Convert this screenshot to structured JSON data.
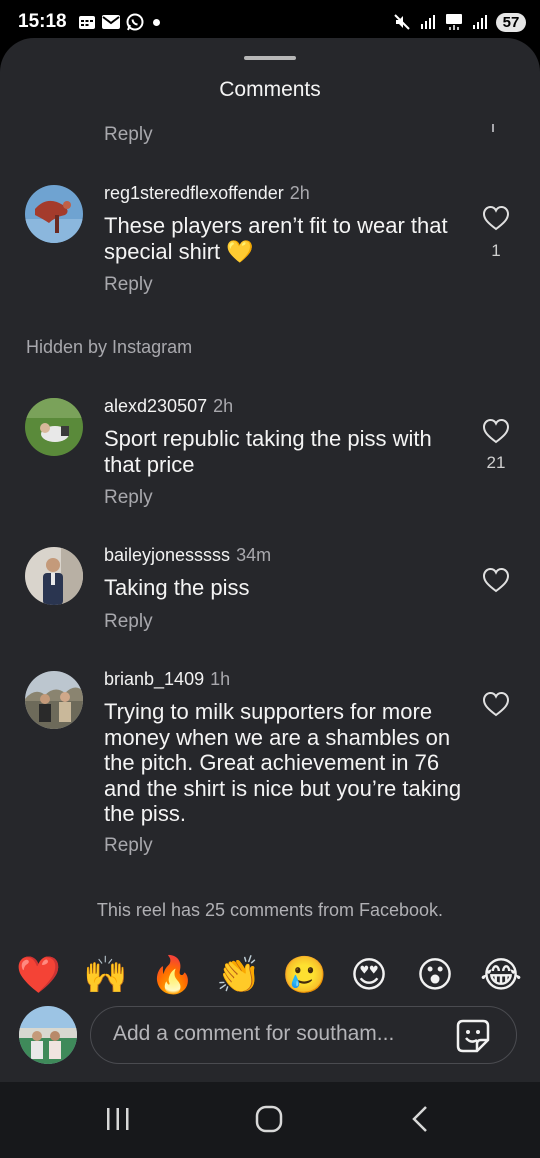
{
  "status_bar": {
    "time": "15:18",
    "left_icons": [
      "calendar-icon",
      "mail-icon",
      "whatsapp-icon"
    ],
    "right_icons": [
      "mute-icon",
      "signal-icon",
      "5g-icon",
      "signal-bars-icon"
    ],
    "battery": "57"
  },
  "sheet": {
    "title": "Comments",
    "top_reply": "Reply",
    "hidden_label": "Hidden by Instagram",
    "footer_note": "This reel has 25 comments from Facebook."
  },
  "comments": [
    {
      "username": "reg1steredflexoffender",
      "time": "2h",
      "text": "These players aren’t fit to wear that special shirt 💛",
      "reply": "Reply",
      "likes": "1"
    },
    {
      "username": "alexd230507",
      "time": "2h",
      "text": "Sport republic taking the piss with that price",
      "reply": "Reply",
      "likes": "21"
    },
    {
      "username": "baileyjonesssss",
      "time": "34m",
      "text": "Taking the piss",
      "reply": "Reply",
      "likes": ""
    },
    {
      "username": "brianb_1409",
      "time": "1h",
      "text": "Trying to milk supporters for more money when we are a shambles on the pitch. Great achievement in 76 and the shirt is nice but you’re taking the piss.",
      "reply": "Reply",
      "likes": ""
    }
  ],
  "emoji_bar": [
    "❤️",
    "🙌",
    "🔥",
    "👏",
    "🥲",
    "😍",
    "😮",
    "😂"
  ],
  "composer": {
    "placeholder": "Add a comment for southam..."
  },
  "nav": [
    "recent-apps-icon",
    "home-icon",
    "back-icon"
  ],
  "colors": {
    "sheet_bg": "#26272b",
    "secondary_text": "#a8a8ad",
    "nav_bg": "#17181b"
  }
}
